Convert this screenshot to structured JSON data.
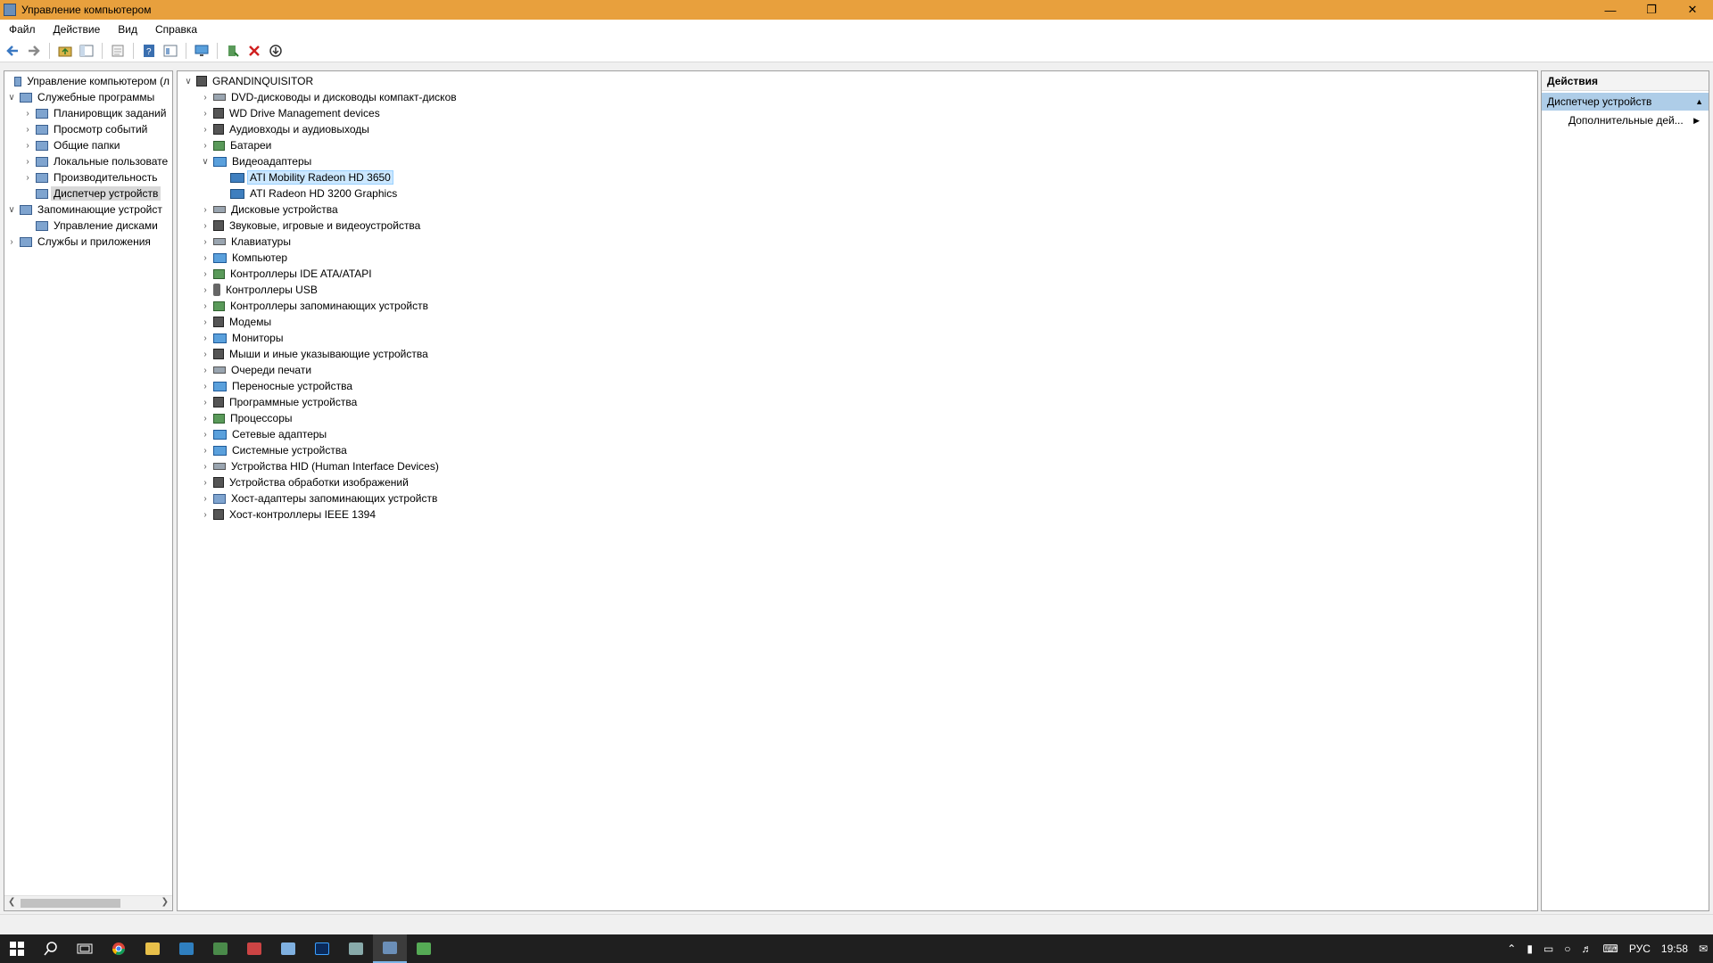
{
  "window": {
    "title": "Управление компьютером",
    "minimize": "—",
    "maximize": "❐",
    "close": "✕"
  },
  "menu": [
    "Файл",
    "Действие",
    "Вид",
    "Справка"
  ],
  "toolbar": {
    "icons": [
      "back-icon",
      "forward-icon",
      "up-icon",
      "show-tree-icon",
      "export-icon",
      "help-icon",
      "properties-icon",
      "monitor-icon",
      "update-driver-icon",
      "uninstall-icon",
      "scan-hardware-icon"
    ]
  },
  "left_tree": [
    {
      "label": "Управление компьютером (л",
      "level": 0,
      "exp": "",
      "icon": "computer-management-icon"
    },
    {
      "label": "Служебные программы",
      "level": 0,
      "exp": "v",
      "icon": "tools-icon"
    },
    {
      "label": "Планировщик заданий",
      "level": 1,
      "exp": ">",
      "icon": "clock-icon"
    },
    {
      "label": "Просмотр событий",
      "level": 1,
      "exp": ">",
      "icon": "event-viewer-icon"
    },
    {
      "label": "Общие папки",
      "level": 1,
      "exp": ">",
      "icon": "shared-folder-icon"
    },
    {
      "label": "Локальные пользовате",
      "level": 1,
      "exp": ">",
      "icon": "users-icon"
    },
    {
      "label": "Производительность",
      "level": 1,
      "exp": ">",
      "icon": "performance-icon"
    },
    {
      "label": "Диспетчер устройств",
      "level": 1,
      "exp": "",
      "icon": "device-manager-icon",
      "selected": true
    },
    {
      "label": "Запоминающие устройст",
      "level": 0,
      "exp": "v",
      "icon": "storage-icon"
    },
    {
      "label": "Управление дисками",
      "level": 1,
      "exp": "",
      "icon": "disk-management-icon"
    },
    {
      "label": "Службы и приложения",
      "level": 0,
      "exp": ">",
      "icon": "services-icon"
    }
  ],
  "device_tree": {
    "root": "GRANDINQUISITOR",
    "categories": [
      {
        "label": "DVD-дисководы и дисководы компакт-дисков",
        "icon": "dvd-icon"
      },
      {
        "label": "WD Drive Management devices",
        "icon": "wd-icon"
      },
      {
        "label": "Аудиовходы и аудиовыходы",
        "icon": "speaker-icon"
      },
      {
        "label": "Батареи",
        "icon": "battery-icon"
      },
      {
        "label": "Видеоадаптеры",
        "icon": "display-adapter-icon",
        "expanded": true,
        "children": [
          {
            "label": "ATI Mobility Radeon HD 3650",
            "selected": true
          },
          {
            "label": "ATI Radeon HD 3200 Graphics"
          }
        ]
      },
      {
        "label": "Дисковые устройства",
        "icon": "disk-drive-icon"
      },
      {
        "label": "Звуковые, игровые и видеоустройства",
        "icon": "sound-icon"
      },
      {
        "label": "Клавиатуры",
        "icon": "keyboard-icon"
      },
      {
        "label": "Компьютер",
        "icon": "computer-icon"
      },
      {
        "label": "Контроллеры IDE ATA/ATAPI",
        "icon": "ide-icon"
      },
      {
        "label": "Контроллеры USB",
        "icon": "usb-icon"
      },
      {
        "label": "Контроллеры запоминающих устройств",
        "icon": "storage-controller-icon"
      },
      {
        "label": "Модемы",
        "icon": "modem-icon"
      },
      {
        "label": "Мониторы",
        "icon": "monitor-icon"
      },
      {
        "label": "Мыши и иные указывающие устройства",
        "icon": "mouse-icon"
      },
      {
        "label": "Очереди печати",
        "icon": "printer-icon"
      },
      {
        "label": "Переносные устройства",
        "icon": "portable-device-icon"
      },
      {
        "label": "Программные устройства",
        "icon": "software-device-icon"
      },
      {
        "label": "Процессоры",
        "icon": "processor-icon"
      },
      {
        "label": "Сетевые адаптеры",
        "icon": "network-icon"
      },
      {
        "label": "Системные устройства",
        "icon": "system-device-icon"
      },
      {
        "label": "Устройства HID (Human Interface Devices)",
        "icon": "hid-icon"
      },
      {
        "label": "Устройства обработки изображений",
        "icon": "imaging-icon"
      },
      {
        "label": "Хост-адаптеры запоминающих устройств",
        "icon": "host-adapter-icon"
      },
      {
        "label": "Хост-контроллеры IEEE 1394",
        "icon": "ieee1394-icon"
      }
    ]
  },
  "actions": {
    "header": "Действия",
    "section": "Диспетчер устройств",
    "items": [
      "Дополнительные дей..."
    ]
  },
  "taskbar": {
    "apps": [
      "start-icon",
      "search-icon",
      "task-view-icon",
      "chrome-icon",
      "explorer-icon",
      "app-icon",
      "app-icon",
      "app-icon",
      "notepad-icon",
      "photoshop-icon",
      "app-icon",
      "computer-management-icon",
      "app-icon"
    ],
    "lang": "РУС",
    "time": "19:58"
  },
  "colors": {
    "titlebar": "#e8a03d",
    "selection": "#cce8ff",
    "action_section": "#aecde8",
    "taskbar": "#1f1f1f"
  }
}
